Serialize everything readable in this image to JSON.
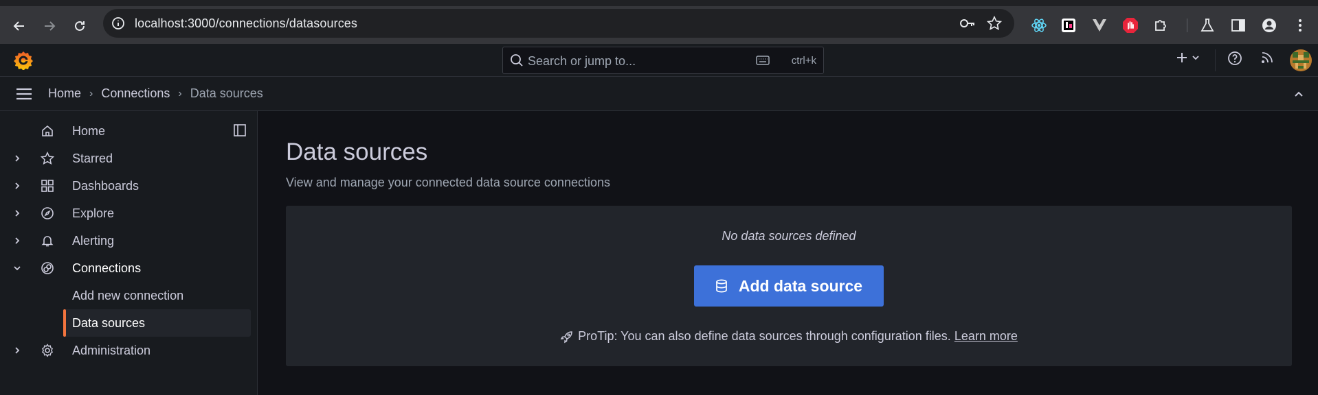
{
  "browser": {
    "url": "localhost:3000/connections/datasources"
  },
  "topbar": {
    "search_placeholder": "Search or jump to...",
    "search_shortcut": "ctrl+k"
  },
  "breadcrumb": [
    {
      "label": "Home"
    },
    {
      "label": "Connections"
    },
    {
      "label": "Data sources"
    }
  ],
  "sidebar": {
    "items": [
      {
        "label": "Home",
        "icon": "home-icon",
        "expandable": false
      },
      {
        "label": "Starred",
        "icon": "star-icon",
        "expandable": true
      },
      {
        "label": "Dashboards",
        "icon": "apps-icon",
        "expandable": true
      },
      {
        "label": "Explore",
        "icon": "compass-icon",
        "expandable": true
      },
      {
        "label": "Alerting",
        "icon": "bell-icon",
        "expandable": true
      },
      {
        "label": "Connections",
        "icon": "connections-icon",
        "expandable": true,
        "expanded": true
      },
      {
        "label": "Administration",
        "icon": "cog-icon",
        "expandable": true
      }
    ],
    "connections_children": [
      {
        "label": "Add new connection",
        "selected": false
      },
      {
        "label": "Data sources",
        "selected": true
      }
    ]
  },
  "main": {
    "title": "Data sources",
    "subtitle": "View and manage your connected data source connections",
    "empty_message": "No data sources defined",
    "add_button_label": "Add data source",
    "protip_text": "ProTip: You can also define data sources through configuration files.",
    "protip_link": "Learn more"
  },
  "colors": {
    "accent": "#f2743e",
    "primary_button": "#3d71d9",
    "background": "#111217",
    "panel": "#181b1f"
  }
}
